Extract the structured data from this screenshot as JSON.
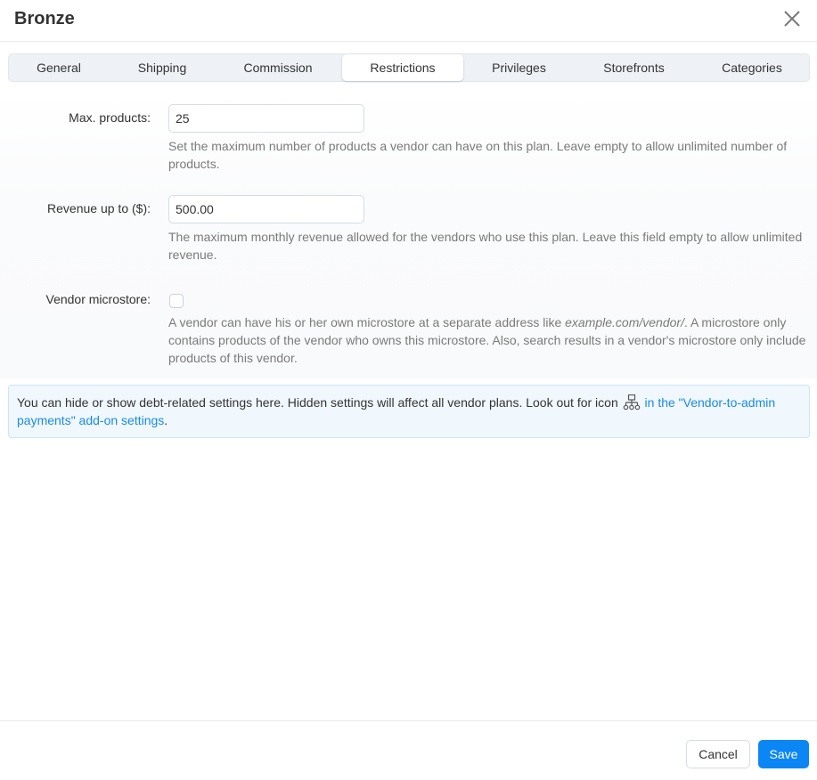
{
  "dialog": {
    "title": "Bronze",
    "close_icon": "close-icon"
  },
  "tabs": [
    {
      "label": "General",
      "active": false
    },
    {
      "label": "Shipping",
      "active": false
    },
    {
      "label": "Commission",
      "active": false
    },
    {
      "label": "Restrictions",
      "active": true
    },
    {
      "label": "Privileges",
      "active": false
    },
    {
      "label": "Storefronts",
      "active": false
    },
    {
      "label": "Categories",
      "active": false
    }
  ],
  "form": {
    "max_products": {
      "label": "Max. products:",
      "value": "25",
      "help": "Set the maximum number of products a vendor can have on this plan. Leave empty to allow unlimited number of products."
    },
    "revenue": {
      "label": "Revenue up to ($):",
      "value": "500.00",
      "help": "The maximum monthly revenue allowed for the vendors who use this plan. Leave this field empty to allow unlimited revenue."
    },
    "microstore": {
      "label": "Vendor microstore:",
      "checked": false,
      "help_before": "A vendor can have his or her own microstore at a separate address like ",
      "help_italic": "example.com/vendor/",
      "help_after": ". A microstore only contains products of the vendor who owns this microstore. Also, search results in a vendor's microstore only include products of this vendor."
    }
  },
  "notice": {
    "text": "You can hide or show debt-related settings here. Hidden settings will affect all vendor plans. Look out for icon",
    "icon": "sitemap-icon",
    "link_text": "in the \"Vendor-to-admin payments\" add-on settings",
    "trailing": "."
  },
  "footer": {
    "cancel_label": "Cancel",
    "save_label": "Save"
  },
  "colors": {
    "primary": "#0b86f5",
    "link": "#1a8ae6",
    "notice_bg": "#f0f8fe"
  }
}
